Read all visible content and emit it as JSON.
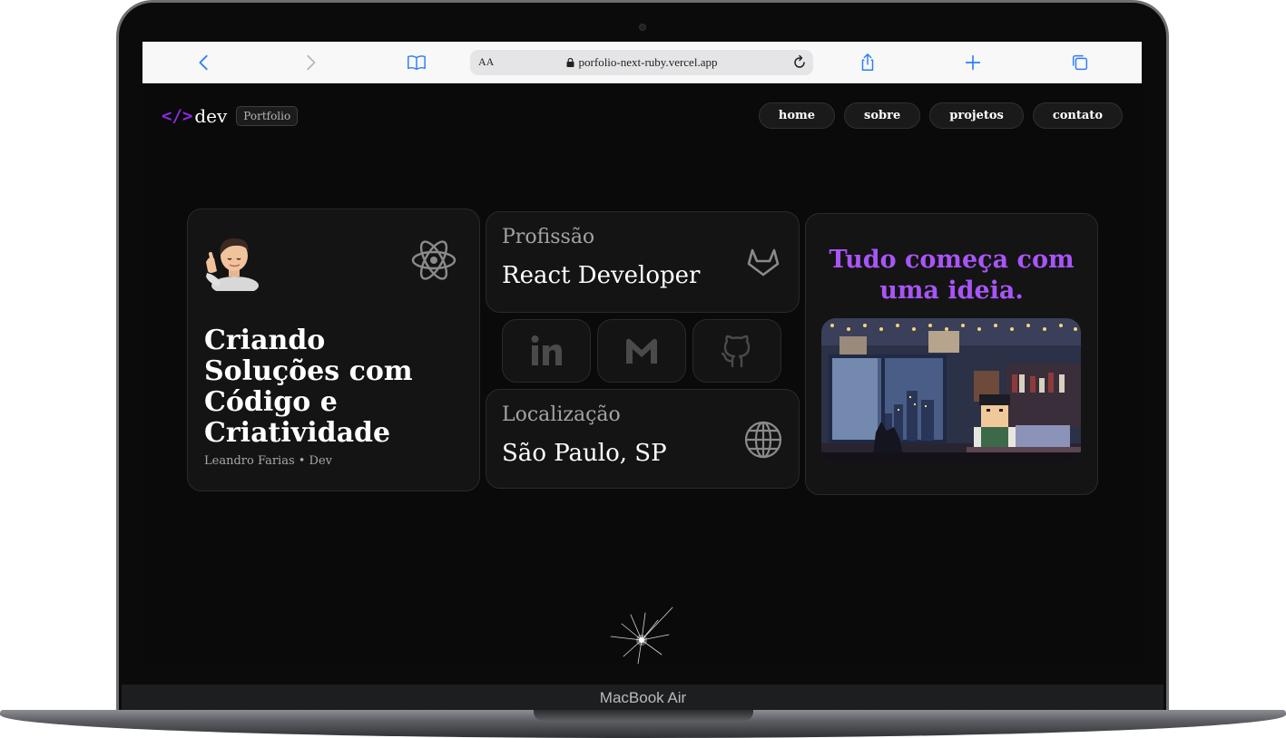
{
  "device": {
    "label": "MacBook Air"
  },
  "browser": {
    "text_size_label": "AA",
    "url": "porfolio-next-ruby.vercel.app"
  },
  "site": {
    "logo_code": "</>",
    "logo_text": "dev",
    "logo_badge": "Portfolio",
    "nav": [
      {
        "label": "home"
      },
      {
        "label": "sobre"
      },
      {
        "label": "projetos"
      },
      {
        "label": "contato"
      }
    ]
  },
  "hero": {
    "title": "Criando Soluções com Código e Criatividade",
    "subtitle": "Leandro Farias • Dev",
    "avatar_icon": "memoji-avatar",
    "tech_icon": "react-icon"
  },
  "profession": {
    "label": "Profissão",
    "value": "React Developer",
    "icon": "gitlab-icon"
  },
  "socials": [
    {
      "name": "linkedin",
      "icon": "linkedin-icon"
    },
    {
      "name": "gmail",
      "icon": "gmail-icon"
    },
    {
      "name": "github",
      "icon": "github-icon"
    }
  ],
  "location": {
    "label": "Localização",
    "value": "São Paulo, SP",
    "icon": "globe-icon"
  },
  "idea": {
    "title": "Tudo começa com uma ideia."
  },
  "colors": {
    "accent": "#a855f7",
    "logo": "#8a2be2",
    "background": "#0a0a0a",
    "card": "#141414"
  }
}
